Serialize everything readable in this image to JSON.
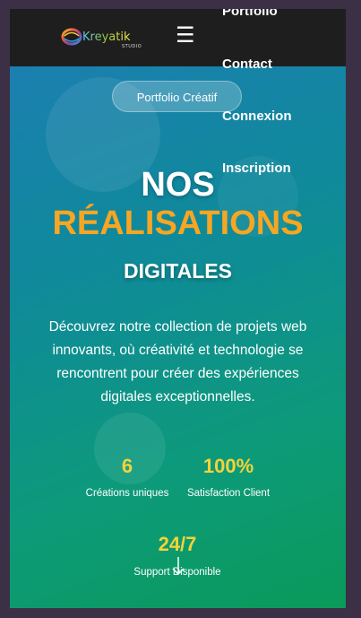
{
  "brand": {
    "name": "Kreyatik",
    "tagline": "STUDIO",
    "colors": {
      "accent_orange": "#f6a623",
      "accent_yellow": "#f3d33a",
      "nav_background": "#1e1e1e"
    }
  },
  "nav": {
    "menu_icon": "hamburger-icon",
    "links": [
      "Portfolio",
      "Contact",
      "Connexion",
      "Inscription"
    ]
  },
  "hero": {
    "badge": "Portfolio Créatif",
    "title_line1": "NOS",
    "title_line2": "RÉALISATIONS",
    "title_line3": "DIGITALES",
    "description": "Découvrez notre collection de projets web innovants, où créativité et technologie se rencontrent pour créer des expériences digitales exceptionnelles."
  },
  "stats": [
    {
      "value": "6",
      "label": "Créations uniques"
    },
    {
      "value": "100%",
      "label": "Satisfaction Client"
    },
    {
      "value": "24/7",
      "label": "Support Disponible"
    }
  ],
  "scroll_indicator": "arrow-down-icon"
}
